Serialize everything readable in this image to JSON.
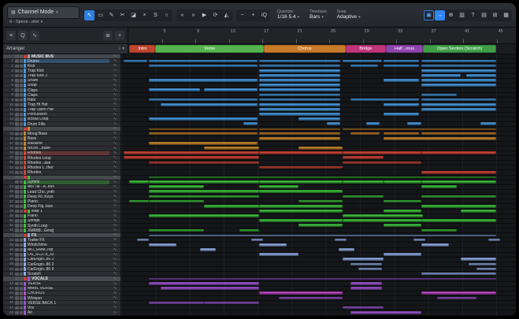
{
  "colors": {
    "accent": "#2f86f6",
    "drums": "#4898dd",
    "bass": "#c8862e",
    "rhodes": "#cc4638",
    "synths": "#3dbf3d",
    "fx": "#8ea9e2",
    "vocals": "#9a55cf",
    "chorusvox": "#bf49c9",
    "bus": "#9a9da1"
  },
  "toolbar": {
    "channel_mode": "Channel Mode",
    "device": "4 - Spectr...eter",
    "tools": [
      {
        "name": "arrow-tool",
        "glyph": "↖",
        "sel": true
      },
      {
        "name": "range-tool",
        "glyph": "▭"
      },
      {
        "name": "draw-tool",
        "glyph": "✎"
      },
      {
        "name": "split-tool",
        "glyph": "✂"
      },
      {
        "name": "eraser-tool",
        "glyph": "◪"
      },
      {
        "name": "mute-tool",
        "glyph": "×"
      },
      {
        "name": "solo-tool",
        "glyph": "S"
      },
      {
        "name": "listen-tool",
        "glyph": "∩"
      }
    ],
    "nav": [
      {
        "name": "rewind-button",
        "glyph": "«"
      },
      {
        "name": "forward-button",
        "glyph": "»"
      },
      {
        "name": "play-button",
        "glyph": "▶"
      },
      {
        "name": "loop-button",
        "glyph": "⟳"
      },
      {
        "name": "metronome-button",
        "glyph": "◭"
      }
    ],
    "zoom": [
      {
        "name": "zoom-out-button",
        "glyph": "−"
      },
      {
        "name": "zoom-in-button",
        "glyph": "+"
      },
      {
        "name": "input-quantize-toggle",
        "glyph": "iQ"
      }
    ],
    "quantize": {
      "label": "Quantize",
      "value": "1/16 5.4"
    },
    "timebase": {
      "label": "Timebase",
      "value": "Bars"
    },
    "snap": {
      "label": "Snap",
      "value": "Adaptive"
    },
    "right": [
      {
        "name": "marker-toggle",
        "glyph": "▣",
        "outline": true
      },
      {
        "name": "follow-button",
        "glyph": "→",
        "accent": true
      },
      {
        "name": "crosshair-icon",
        "glyph": "⊕"
      },
      {
        "name": "mixer-button",
        "glyph": "▥"
      },
      {
        "name": "help-button",
        "glyph": "?"
      },
      {
        "name": "keyboard-button",
        "glyph": "▤"
      },
      {
        "name": "editor-button",
        "glyph": "⊞"
      },
      {
        "name": "browser-button",
        "glyph": "▦"
      }
    ]
  },
  "panel": {
    "icons": [
      {
        "name": "track-list-icon",
        "glyph": "≡"
      },
      {
        "name": "search-icon",
        "glyph": "Q"
      },
      {
        "name": "transform-icon",
        "glyph": "∿"
      }
    ],
    "right_icons": [
      {
        "name": "sort-icon",
        "glyph": "≣"
      },
      {
        "name": "add-track-button",
        "glyph": "+"
      }
    ]
  },
  "ruler": {
    "bars": [
      {
        "n": "5",
        "pct": 8.64
      },
      {
        "n": "9",
        "pct": 17.28
      },
      {
        "n": "13",
        "pct": 25.92
      },
      {
        "n": "17",
        "pct": 34.56
      },
      {
        "n": "21",
        "pct": 43.2
      },
      {
        "n": "25",
        "pct": 51.84
      },
      {
        "n": "29",
        "pct": 60.48
      },
      {
        "n": "33",
        "pct": 69.12
      },
      {
        "n": "37",
        "pct": 77.76
      },
      {
        "n": "41",
        "pct": 86.4
      },
      {
        "n": "45",
        "pct": 95.04
      }
    ]
  },
  "arranger": {
    "label": "Arranger",
    "sections": [
      {
        "label": "Intro",
        "color": "#c0452f",
        "start": 0.3,
        "width": 6.7
      },
      {
        "label": "Verse",
        "color": "#56b44e",
        "start": 7,
        "width": 28
      },
      {
        "label": "Chorus",
        "color": "#c97a28",
        "start": 35,
        "width": 21
      },
      {
        "label": "Bridge",
        "color": "#c2357b",
        "start": 56,
        "width": 10.5
      },
      {
        "label": "Half ..orus",
        "color": "#8e44ad",
        "start": 66.5,
        "width": 9.5
      },
      {
        "label": "Open Section (Scratch)",
        "color": "#3e9e46",
        "start": 76,
        "width": 19
      }
    ]
  },
  "tracks": [
    {
      "n": "",
      "name": "MUSIC BUS",
      "g": "bus",
      "t": "bus",
      "rec": true,
      "clips": []
    },
    {
      "n": "1",
      "name": "Drums",
      "g": "drums",
      "t": "folder",
      "clips": [
        [
          0.5,
          6
        ],
        [
          7,
          27.5
        ],
        [
          35,
          20.5
        ],
        [
          56,
          10
        ],
        [
          66.5,
          9
        ],
        [
          76,
          19
        ]
      ]
    },
    {
      "n": "2",
      "name": "Kick",
      "g": "drums",
      "t": "track",
      "clips": [
        [
          7,
          27.5
        ],
        [
          35,
          20.5
        ],
        [
          58,
          7
        ],
        [
          66.5,
          9
        ],
        [
          76,
          19
        ]
      ]
    },
    {
      "n": "3",
      "name": "Trap Kick",
      "g": "drums",
      "t": "track",
      "clips": [
        [
          35,
          20.5
        ],
        [
          76,
          19
        ]
      ]
    },
    {
      "n": "4",
      "name": "Trap Kick 2",
      "g": "drums",
      "t": "track",
      "clips": [
        [
          35,
          20.5
        ],
        [
          76,
          10
        ],
        [
          87.5,
          7.5
        ]
      ]
    },
    {
      "n": "5",
      "name": "Snare",
      "g": "drums",
      "t": "track",
      "clips": [
        [
          7,
          27.5
        ],
        [
          35,
          20.5
        ],
        [
          66.5,
          9
        ],
        [
          76,
          19
        ]
      ]
    },
    {
      "n": "6",
      "name": "Snap",
      "g": "drums",
      "t": "track",
      "clips": [
        [
          35,
          20.5
        ],
        [
          76,
          19
        ]
      ]
    },
    {
      "n": "7",
      "name": "Claps",
      "g": "drums",
      "t": "track",
      "clips": [
        [
          7,
          13
        ],
        [
          21,
          13.5
        ],
        [
          35,
          20.5
        ]
      ]
    },
    {
      "n": "8",
      "name": "Claps",
      "g": "drums",
      "t": "track",
      "clips": [
        [
          35,
          20.5
        ],
        [
          76,
          9
        ]
      ]
    },
    {
      "n": "9",
      "name": "Hats",
      "g": "drums",
      "t": "track",
      "clips": [
        [
          7,
          27.5
        ],
        [
          35,
          20.5
        ],
        [
          58,
          17.5
        ],
        [
          76,
          19
        ]
      ]
    },
    {
      "n": "10",
      "name": "Trap Hi Hat",
      "g": "drums",
      "t": "track",
      "clips": [
        [
          10,
          24.5
        ],
        [
          35,
          20.5
        ],
        [
          66.5,
          9
        ],
        [
          76,
          19
        ]
      ]
    },
    {
      "n": "11",
      "name": "Trap Open Hat",
      "g": "drums",
      "t": "track",
      "clips": [
        [
          35,
          20.5
        ],
        [
          76,
          19
        ]
      ]
    },
    {
      "n": "12",
      "name": "Percussion",
      "g": "drums",
      "t": "track",
      "clips": [
        [
          35,
          20.5
        ],
        [
          66.5,
          9
        ]
      ]
    },
    {
      "n": "13",
      "name": "Bossa Loop",
      "g": "drums",
      "t": "track",
      "clips": [
        [
          7,
          27.5
        ],
        [
          45,
          10.5
        ]
      ]
    },
    {
      "n": "14",
      "name": "Drum Fills",
      "g": "drums",
      "t": "track",
      "clips": [
        [
          31,
          3.5
        ],
        [
          52,
          3.5
        ],
        [
          62,
          3.5
        ],
        [
          72.5,
          3.5
        ],
        [
          91,
          4
        ]
      ]
    },
    {
      "n": "",
      "name": "",
      "g": "bass",
      "t": "bus",
      "rec": true,
      "clips": [
        [
          7,
          27.5
        ],
        [
          35,
          20.5
        ],
        [
          56,
          39
        ]
      ]
    },
    {
      "n": "15",
      "name": "Moog Bass",
      "g": "bass",
      "t": "track",
      "clips": [
        [
          7,
          27.5
        ],
        [
          35,
          20.5
        ],
        [
          58,
          7.5
        ],
        [
          66.5,
          9
        ],
        [
          76,
          19
        ]
      ]
    },
    {
      "n": "16",
      "name": "Bass",
      "g": "bass",
      "t": "track",
      "clips": [
        [
          35,
          20.5
        ],
        [
          66.5,
          28.5
        ]
      ]
    },
    {
      "n": "17",
      "name": "Bassline",
      "g": "bass",
      "t": "track",
      "clips": [
        [
          7,
          27.5
        ]
      ]
    },
    {
      "n": "18",
      "name": "Nh2th...Base",
      "g": "bass",
      "t": "track",
      "clips": [
        [
          21,
          14
        ],
        [
          45,
          11
        ]
      ]
    },
    {
      "n": "19",
      "name": "Rhodes",
      "g": "rhodes",
      "t": "folder",
      "clips": [
        [
          0.5,
          34.5
        ],
        [
          35,
          21
        ],
        [
          56,
          20
        ],
        [
          76,
          19
        ]
      ]
    },
    {
      "n": "20",
      "name": "Rhodes Loop",
      "g": "rhodes",
      "t": "track",
      "clips": [
        [
          0.5,
          34.5
        ],
        [
          56,
          10.5
        ]
      ]
    },
    {
      "n": "21",
      "name": "Rhodes ..ase",
      "g": "rhodes",
      "t": "track",
      "clips": [
        [
          7,
          28
        ],
        [
          56,
          20
        ]
      ]
    },
    {
      "n": "22",
      "name": "Rhodes L..ther",
      "g": "rhodes",
      "t": "track",
      "clips": [
        [
          35,
          21
        ]
      ]
    },
    {
      "n": "23",
      "name": "Rhodes",
      "g": "rhodes",
      "t": "track",
      "clips": [
        [
          76,
          19
        ]
      ]
    },
    {
      "n": "",
      "name": "",
      "g": "synths",
      "t": "bus",
      "rec": true,
      "clips": [
        [
          7,
          88
        ]
      ]
    },
    {
      "n": "",
      "name": "Synths",
      "g": "synths",
      "t": "folder",
      "clips": [
        [
          2,
          5
        ],
        [
          7,
          28
        ],
        [
          35,
          21
        ],
        [
          56,
          10.5
        ],
        [
          66.5,
          9.5
        ],
        [
          76,
          19
        ]
      ]
    },
    {
      "n": "24",
      "name": "Msi Tal - A..eIIx",
      "g": "synths",
      "t": "track",
      "clips": [
        [
          7,
          14
        ],
        [
          35,
          10
        ],
        [
          76,
          9
        ]
      ]
    },
    {
      "n": "25",
      "name": "Lead Cho..ynth",
      "g": "synths",
      "t": "track",
      "clips": [
        [
          7,
          28
        ],
        [
          35,
          21
        ]
      ]
    },
    {
      "n": "26",
      "name": "Deep Fil..Keys",
      "g": "synths",
      "t": "track",
      "clips": [
        [
          7,
          28
        ],
        [
          56,
          10.5
        ],
        [
          76,
          19
        ]
      ]
    },
    {
      "n": "27",
      "name": "Piano",
      "g": "synths",
      "t": "track",
      "clips": [
        [
          2,
          5
        ],
        [
          7,
          14
        ],
        [
          45,
          11
        ],
        [
          66.5,
          9.5
        ]
      ]
    },
    {
      "n": "28",
      "name": "Deep Fig..lass",
      "g": "synths",
      "t": "track",
      "clips": [
        [
          21,
          14
        ],
        [
          35,
          21
        ],
        [
          76,
          19
        ]
      ]
    },
    {
      "n": "29",
      "name": "lead 1",
      "g": "synths",
      "t": "track",
      "rec": true,
      "clips": [
        [
          35,
          21
        ],
        [
          66.5,
          9.5
        ],
        [
          86,
          9
        ]
      ]
    },
    {
      "n": "30",
      "name": "Piano",
      "g": "synths",
      "t": "track",
      "clips": [
        [
          7,
          28
        ],
        [
          56,
          20.5
        ]
      ]
    },
    {
      "n": "31",
      "name": "Strings",
      "g": "synths",
      "t": "track",
      "clips": [
        [
          35,
          21
        ],
        [
          56,
          20.5
        ],
        [
          76,
          19
        ]
      ]
    },
    {
      "n": "32",
      "name": "Synth Loop",
      "g": "synths",
      "t": "track",
      "clips": [
        [
          45,
          11
        ],
        [
          66.5,
          9.5
        ]
      ]
    },
    {
      "n": "33",
      "name": "XMR88...Gmq]",
      "g": "synths",
      "t": "track",
      "clips": [
        [
          7,
          14
        ],
        [
          30,
          5
        ],
        [
          76,
          9
        ]
      ]
    },
    {
      "n": "",
      "name": "FX",
      "g": "fx",
      "t": "bus",
      "rec": true,
      "clips": [
        [
          7,
          88
        ]
      ]
    },
    {
      "n": "34",
      "name": "Trailer FX",
      "g": "fx",
      "t": "track",
      "clips": [
        [
          4,
          3
        ],
        [
          33,
          3
        ],
        [
          54,
          3
        ],
        [
          74,
          3
        ],
        [
          93,
          3
        ]
      ]
    },
    {
      "n": "35",
      "name": "Windchime",
      "g": "fx",
      "t": "track",
      "clips": [
        [
          7,
          7
        ],
        [
          35,
          7
        ],
        [
          76,
          7
        ]
      ]
    },
    {
      "n": "36",
      "name": "MO_EMM..rsp",
      "g": "fx",
      "t": "track",
      "clips": [
        [
          20,
          4
        ],
        [
          55,
          4
        ]
      ]
    },
    {
      "n": "37",
      "name": "OS_SC3..lt_33",
      "g": "fx",
      "t": "track",
      "clips": [
        [
          35,
          10
        ],
        [
          66.5,
          9.5
        ]
      ]
    },
    {
      "n": "38",
      "name": "CarEngin..86 2",
      "g": "fx",
      "t": "track",
      "clips": [
        [
          56,
          10.5
        ],
        [
          86,
          9
        ]
      ]
    },
    {
      "n": "39",
      "name": "CarEngin..86 2",
      "g": "fx",
      "t": "track",
      "clips": [
        [
          58,
          8
        ],
        [
          88,
          7
        ]
      ]
    },
    {
      "n": "40",
      "name": "CarEngin..86 II",
      "g": "fx",
      "t": "track",
      "clips": [
        [
          60,
          6
        ],
        [
          90,
          5
        ]
      ]
    },
    {
      "n": "41",
      "name": "Scratch",
      "g": "fx",
      "t": "track",
      "clips": [
        [
          76,
          19
        ]
      ]
    },
    {
      "n": "",
      "name": "VOCALS",
      "g": "vocals",
      "t": "bus",
      "rec": true,
      "clips": [
        [
          7,
          88
        ]
      ]
    },
    {
      "n": "42",
      "name": "VERSE",
      "g": "vocals",
      "t": "track",
      "clips": [
        [
          7,
          28
        ],
        [
          58,
          8
        ]
      ]
    },
    {
      "n": "43",
      "name": "MMBL VERSE",
      "g": "vocals",
      "t": "track",
      "clips": [
        [
          10,
          25
        ],
        [
          58,
          8
        ]
      ]
    },
    {
      "n": "44",
      "name": "CHORUS",
      "g": "chorusvox",
      "t": "track",
      "clips": [
        [
          35,
          21
        ],
        [
          76,
          19
        ]
      ]
    },
    {
      "n": "45",
      "name": "Whisper",
      "g": "vocals",
      "t": "track",
      "clips": [
        [
          40,
          16
        ],
        [
          80,
          10
        ]
      ]
    },
    {
      "n": "46",
      "name": "VERSE BACK 1",
      "g": "vocals",
      "t": "track",
      "clips": [
        [
          7,
          14
        ],
        [
          21,
          14
        ]
      ]
    },
    {
      "n": "47",
      "name": "Vox",
      "g": "vocals",
      "t": "track",
      "clips": [
        [
          56,
          10.5
        ]
      ]
    },
    {
      "n": "48",
      "name": "Air",
      "g": "vocals",
      "t": "track",
      "clips": [
        [
          58,
          18
        ]
      ]
    }
  ]
}
